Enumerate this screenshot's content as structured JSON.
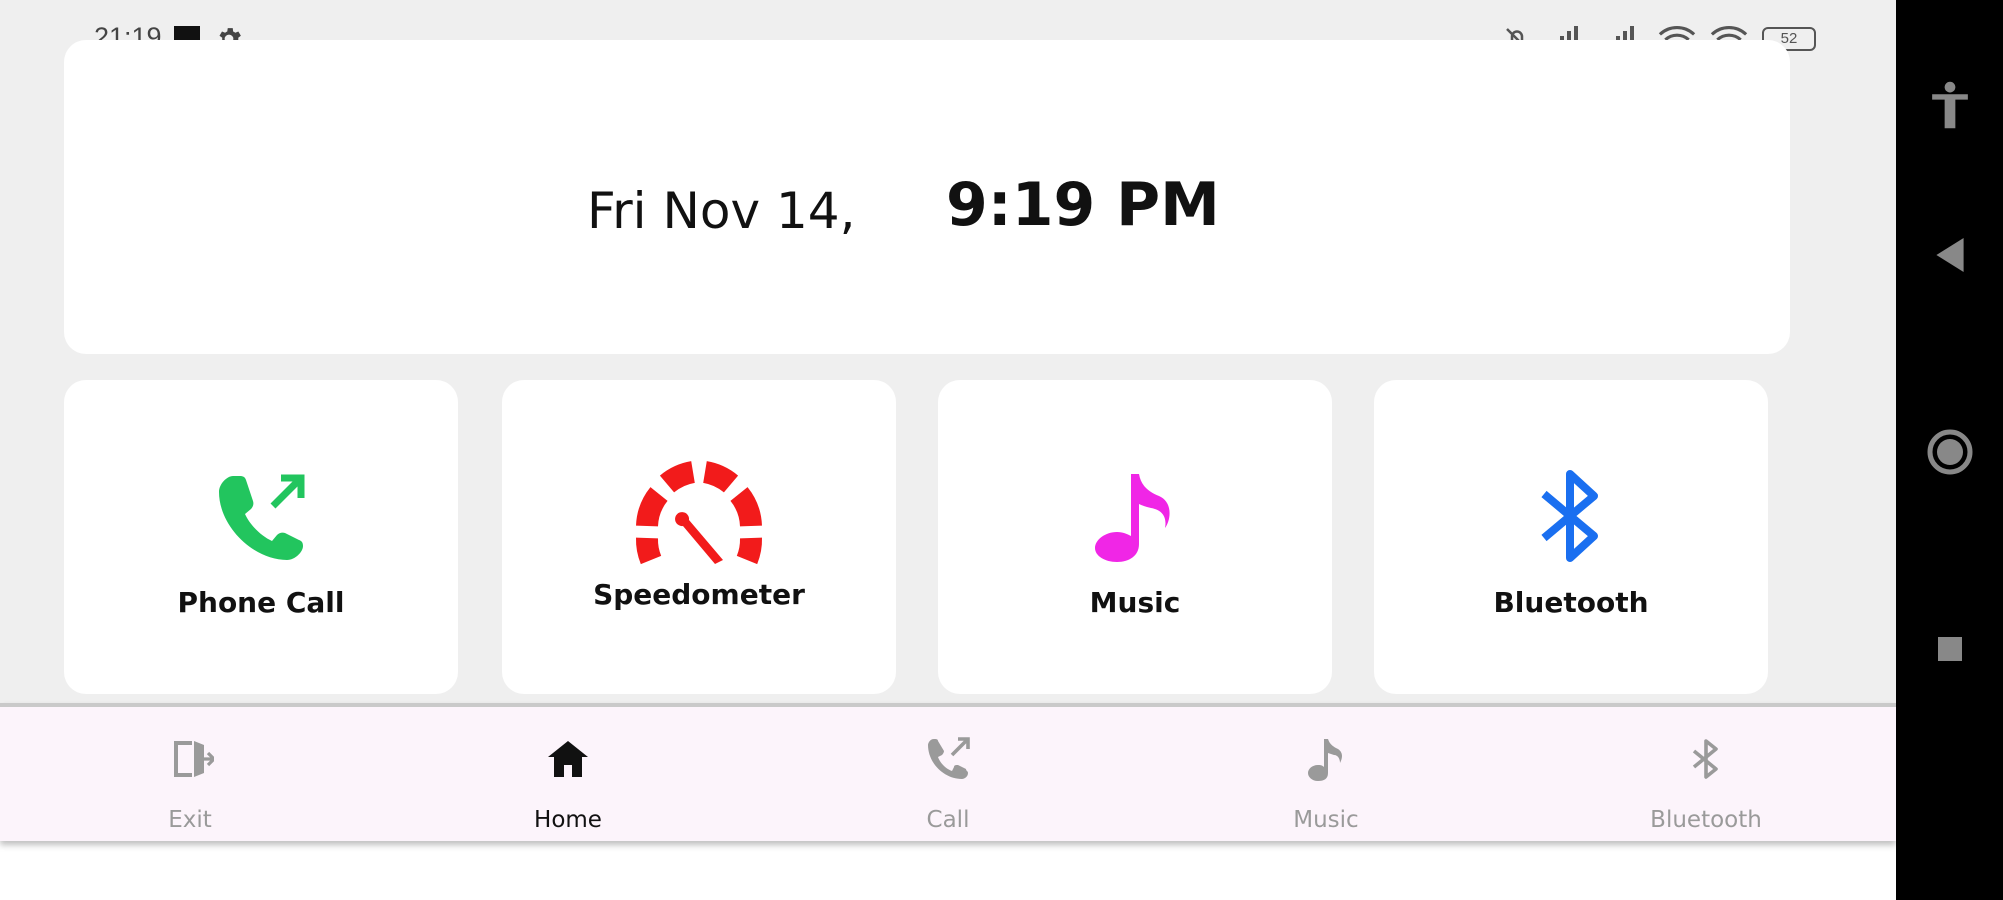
{
  "status_bar": {
    "time": "21:19",
    "battery": "52"
  },
  "clock": {
    "date": "Fri Nov 14,",
    "time": "9:19 PM"
  },
  "tiles": [
    {
      "label": "Phone Call",
      "icon": "phone-call-icon",
      "color": "#22c55e"
    },
    {
      "label": "Speedometer",
      "icon": "speedometer-icon",
      "color": "#f21b1b"
    },
    {
      "label": "Music",
      "icon": "music-note-icon",
      "color": "#f026e6"
    },
    {
      "label": "Bluetooth",
      "icon": "bluetooth-icon",
      "color": "#1a6ff0"
    }
  ],
  "bottom_nav": {
    "items": [
      {
        "label": "Exit",
        "icon": "exit-icon",
        "active": false
      },
      {
        "label": "Home",
        "icon": "home-icon",
        "active": true
      },
      {
        "label": "Call",
        "icon": "call-icon",
        "active": false
      },
      {
        "label": "Music",
        "icon": "music-icon",
        "active": false
      },
      {
        "label": "Bluetooth",
        "icon": "bluetooth-icon",
        "active": false
      }
    ]
  },
  "system_nav": {
    "buttons": [
      "accessibility-icon",
      "back-icon",
      "home-circle-icon",
      "recents-icon"
    ]
  },
  "colors": {
    "background": "#efefef",
    "card": "#ffffff",
    "nav_bg": "#fcf4fb",
    "inactive": "#9a9a9a"
  }
}
